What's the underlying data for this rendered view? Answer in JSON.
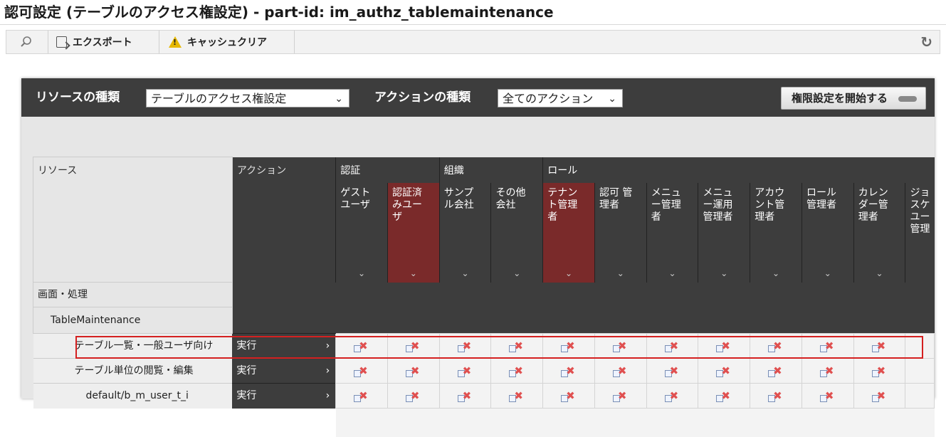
{
  "title": "認可設定 (テーブルのアクセス権設定) - part-id: im_authz_tablemaintenance",
  "toolbar": {
    "search_icon": "search-icon",
    "export_label": "エクスポート",
    "cache_label": "キャッシュクリア",
    "reload_icon": "reload-icon"
  },
  "filter": {
    "resource_type_label": "リソースの種類",
    "resource_type_value": "テーブルのアクセス権設定",
    "action_type_label": "アクションの種類",
    "action_type_value": "全てのアクション",
    "start_button": "権限設定を開始する"
  },
  "grid": {
    "resource_header": "リソース",
    "action_header": "アクション",
    "groups": [
      {
        "label": "認証",
        "span": 2
      },
      {
        "label": "組織",
        "span": 2
      },
      {
        "label": "ロール",
        "span": 7
      }
    ],
    "columns": [
      {
        "lines": [
          "ゲスト",
          "ユーザ"
        ],
        "highlight": false
      },
      {
        "lines": [
          "認証済",
          "みユー",
          "ザ"
        ],
        "highlight": true
      },
      {
        "lines": [
          "サンプ",
          "ル会社"
        ],
        "highlight": false
      },
      {
        "lines": [
          "その他",
          "会社"
        ],
        "highlight": false
      },
      {
        "lines": [
          "テナン",
          "ト管理",
          "者"
        ],
        "highlight": true
      },
      {
        "lines": [
          "認可 管",
          "理者"
        ],
        "highlight": false
      },
      {
        "lines": [
          "メニュ",
          "ー管理",
          "者"
        ],
        "highlight": false
      },
      {
        "lines": [
          "メニュ",
          "ー運用",
          "管理者"
        ],
        "highlight": false
      },
      {
        "lines": [
          "アカウ",
          "ント管",
          "理者"
        ],
        "highlight": false
      },
      {
        "lines": [
          "ロール",
          "管理者"
        ],
        "highlight": false
      },
      {
        "lines": [
          "カレン",
          "ダー管",
          "理者"
        ],
        "highlight": false
      }
    ],
    "partial_column": {
      "lines": [
        "ジョ",
        "スケ",
        "ユー",
        "管理"
      ]
    },
    "level1": "画面・処理",
    "level2": "TableMaintenance",
    "rows": [
      {
        "name": "テーブル一覧・一般ユーザ向け",
        "action": "実行",
        "indent": 1
      },
      {
        "name": "テーブル単位の閲覧・編集",
        "action": "実行",
        "indent": 1
      },
      {
        "name": "default/b_m_user_t_i",
        "action": "実行",
        "indent": 2
      }
    ]
  },
  "colors": {
    "header_dark": "#3d3d3d",
    "highlight_column": "#7a2a2a",
    "deny_mark": "#e05050",
    "selection_outline": "#d42020"
  }
}
